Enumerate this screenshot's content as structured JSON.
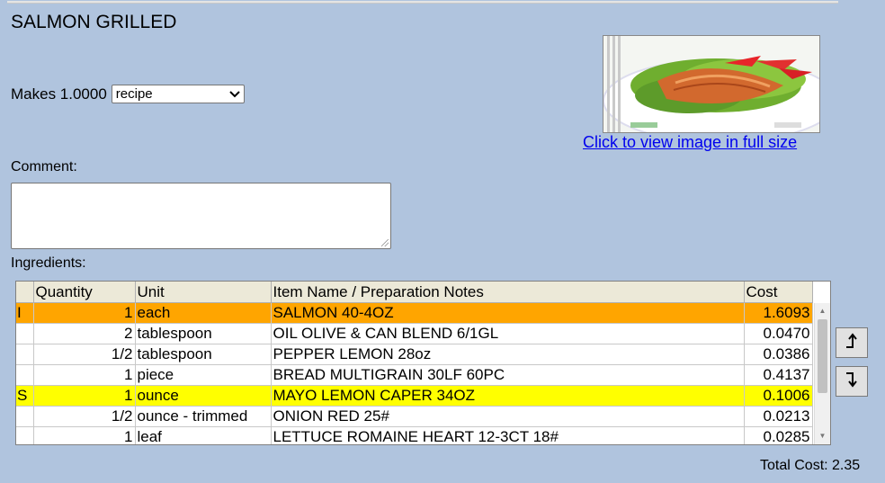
{
  "title": "SALMON GRILLED",
  "makes": {
    "label": "Makes 1.0000",
    "unit_selected": "recipe"
  },
  "image": {
    "link_text": "Click to view image in full size"
  },
  "comment": {
    "label": "Comment:",
    "value": ""
  },
  "ingredients": {
    "label": "Ingredients:",
    "columns": [
      "",
      "Quantity",
      "Unit",
      "Item Name / Preparation Notes",
      "Cost"
    ],
    "rows": [
      {
        "flag": "I",
        "quantity": "1",
        "unit": "each",
        "item": "SALMON 40-4OZ",
        "cost": "1.6093",
        "highlight": "orange"
      },
      {
        "flag": "",
        "quantity": "2",
        "unit": "tablespoon",
        "item": "OIL OLIVE & CAN BLEND 6/1GL",
        "cost": "0.0470",
        "highlight": ""
      },
      {
        "flag": "",
        "quantity": "1/2",
        "unit": "tablespoon",
        "item": "PEPPER LEMON 28oz",
        "cost": "0.0386",
        "highlight": ""
      },
      {
        "flag": "",
        "quantity": "1",
        "unit": "piece",
        "item": "BREAD MULTIGRAIN 30LF 60PC",
        "cost": "0.4137",
        "highlight": ""
      },
      {
        "flag": "S",
        "quantity": "1",
        "unit": "ounce",
        "item": "MAYO LEMON CAPER 34OZ",
        "cost": "0.1006",
        "highlight": "yellow"
      },
      {
        "flag": "",
        "quantity": "1/2",
        "unit": "ounce - trimmed",
        "item": "ONION RED 25#",
        "cost": "0.0213",
        "highlight": ""
      },
      {
        "flag": "",
        "quantity": "1",
        "unit": "leaf",
        "item": "LETTUCE ROMAINE HEART 12-3CT 18#",
        "cost": "0.0285",
        "highlight": ""
      }
    ]
  },
  "total": {
    "label": "Total Cost: 2.35"
  },
  "colors": {
    "background": "#b0c4de",
    "orange_row": "#ffa500",
    "yellow_row": "#ffff00",
    "link": "#0000ee"
  },
  "icons": {
    "move_up": "arrow-up-icon",
    "move_down": "arrow-down-icon",
    "dropdown": "chevron-down-icon"
  }
}
